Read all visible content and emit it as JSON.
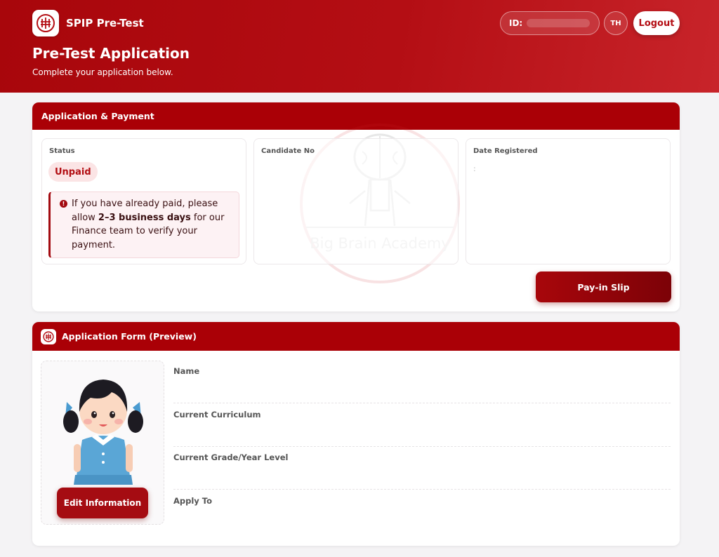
{
  "header": {
    "app_name": "SPIP Pre-Test",
    "title": "Pre-Test Application",
    "subtitle": "Complete your application below.",
    "id_label": "ID:",
    "lang": "TH",
    "logout": "Logout"
  },
  "payment": {
    "section_title": "Application & Payment",
    "status_label": "Status",
    "status_value": "Unpaid",
    "notice_pre": "If you have already paid, please allow ",
    "notice_bold": "2–3 business days",
    "notice_post": " for our Finance team to verify your payment.",
    "candidate_label": "Candidate No",
    "date_label": "Date Registered",
    "date_value": ":",
    "payslip_button": "Pay-in Slip",
    "watermark_text": "Big Brain Academy"
  },
  "form": {
    "section_title": "Application Form (Preview)",
    "edit_button": "Edit Information",
    "fields": [
      {
        "label": "Name"
      },
      {
        "label": "Current Curriculum"
      },
      {
        "label": "Current Grade/Year Level"
      },
      {
        "label": "Apply To"
      }
    ]
  },
  "colors": {
    "brand_red": "#aa0006",
    "status_bg": "#fbe4e5",
    "status_text": "#b20d12"
  },
  "icons": {
    "logo": "school-logo-icon",
    "notice": "info-circle-icon"
  }
}
